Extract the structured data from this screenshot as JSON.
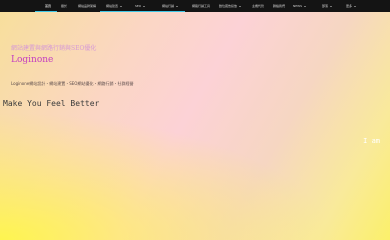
{
  "nav": {
    "items": [
      {
        "label": "首頁",
        "has_dropdown": false,
        "active": true
      },
      {
        "label": "關於",
        "has_dropdown": false,
        "active": false
      },
      {
        "label": "網站品牌架構",
        "has_dropdown": false,
        "active": false
      },
      {
        "label": "網站建置",
        "has_dropdown": true,
        "active": false
      },
      {
        "label": "SEO",
        "has_dropdown": true,
        "active": false
      },
      {
        "label": "網站行銷",
        "has_dropdown": true,
        "active": false
      },
      {
        "label": "網路行銷工具",
        "has_dropdown": false,
        "active": false
      },
      {
        "label": "數位廣告投放",
        "has_dropdown": true,
        "active": false
      },
      {
        "label": "主機代管",
        "has_dropdown": false,
        "active": false
      },
      {
        "label": "聯絡我們",
        "has_dropdown": false,
        "active": false
      },
      {
        "label": "NEWS",
        "has_dropdown": true,
        "active": false
      },
      {
        "label": "部落",
        "has_dropdown": true,
        "active": false
      },
      {
        "label": "更多",
        "has_dropdown": true,
        "active": false
      }
    ],
    "accent_color": "#3ec7e6"
  },
  "hero": {
    "site_title": "網站建置與網路行銷與SEO優化",
    "logo_text": "Loginone",
    "tagline": "Loginone網站設計・網站建置・SEO網站優化・網路行銷・社群經營",
    "headline": "Make You Feel Better",
    "typing_text": "I am"
  }
}
